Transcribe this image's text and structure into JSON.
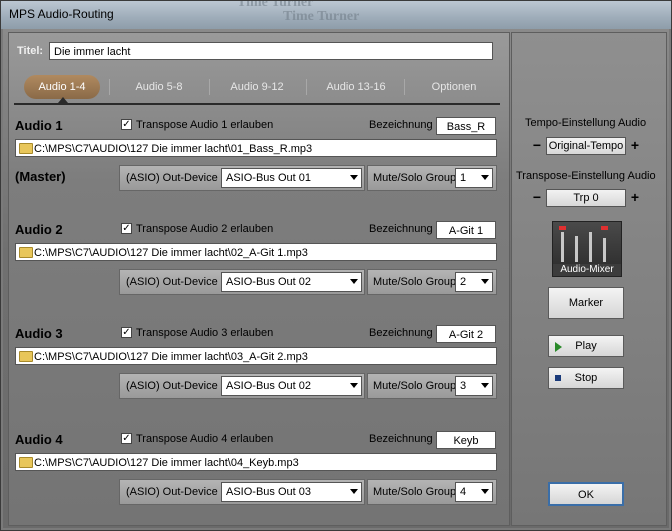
{
  "window": {
    "title": "MPS Audio-Routing",
    "bg_text_1": "Time Turner",
    "bg_text_2": "Time Turner"
  },
  "header": {
    "title_label": "Titel:",
    "title_value": "Die immer lacht"
  },
  "tabs": [
    {
      "label": "Audio 1-4",
      "active": true
    },
    {
      "label": "Audio 5-8",
      "active": false
    },
    {
      "label": "Audio 9-12",
      "active": false
    },
    {
      "label": "Audio 13-16",
      "active": false
    },
    {
      "label": "Optionen",
      "active": false
    }
  ],
  "tracks": [
    {
      "name": "Audio 1",
      "sub": "(Master)",
      "transpose_label": "Transpose Audio 1 erlauben",
      "transpose_checked": true,
      "bez_label": "Bezeichnung",
      "bez_value": "Bass_R",
      "path": "C:\\MPS\\C7\\AUDIO\\127 Die immer lacht\\01_Bass_R.mp3",
      "out_label": "(ASIO) Out-Device",
      "out_value": "ASIO-Bus Out 01",
      "mute_label": "Mute/Solo Group",
      "mute_value": "1"
    },
    {
      "name": "Audio 2",
      "sub": "",
      "transpose_label": "Transpose Audio 2 erlauben",
      "transpose_checked": true,
      "bez_label": "Bezeichnung",
      "bez_value": "A-Git 1",
      "path": "C:\\MPS\\C7\\AUDIO\\127 Die immer lacht\\02_A-Git 1.mp3",
      "out_label": "(ASIO) Out-Device",
      "out_value": "ASIO-Bus Out 02",
      "mute_label": "Mute/Solo Group",
      "mute_value": "2"
    },
    {
      "name": "Audio 3",
      "sub": "",
      "transpose_label": "Transpose Audio 3 erlauben",
      "transpose_checked": true,
      "bez_label": "Bezeichnung",
      "bez_value": "A-Git 2",
      "path": "C:\\MPS\\C7\\AUDIO\\127 Die immer lacht\\03_A-Git 2.mp3",
      "out_label": "(ASIO) Out-Device",
      "out_value": "ASIO-Bus Out 02",
      "mute_label": "Mute/Solo Group",
      "mute_value": "3"
    },
    {
      "name": "Audio 4",
      "sub": "",
      "transpose_label": "Transpose Audio 4 erlauben",
      "transpose_checked": true,
      "bez_label": "Bezeichnung",
      "bez_value": "Keyb",
      "path": "C:\\MPS\\C7\\AUDIO\\127 Die immer lacht\\04_Keyb.mp3",
      "out_label": "(ASIO) Out-Device",
      "out_value": "ASIO-Bus Out 03",
      "mute_label": "Mute/Solo Group",
      "mute_value": "4"
    }
  ],
  "side": {
    "tempo_label": "Tempo-Einstellung Audio",
    "tempo_value": "Original-Tempo",
    "transpose_label": "Transpose-Einstellung Audio",
    "transpose_value": "Trp 0",
    "minus": "−",
    "plus": "+",
    "mixer_label": "Audio-Mixer",
    "marker_label": "Marker",
    "play_label": "Play",
    "stop_label": "Stop",
    "ok_label": "OK"
  },
  "colors": {
    "active_tab": "#9a7654",
    "panel_bg": "#7d7d7d"
  }
}
